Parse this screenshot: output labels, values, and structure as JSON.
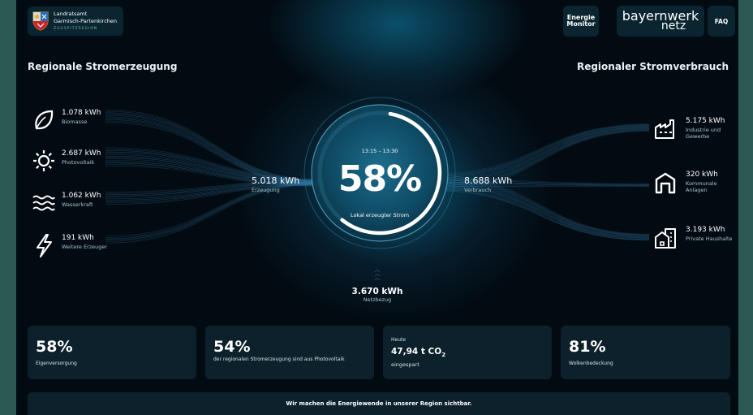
{
  "header": {
    "logo": {
      "line1": "Landratsamt",
      "line2": "Garmisch-Partenkirchen",
      "line3": "ZUGSPITZREGION"
    },
    "energy_monitor": {
      "line1": "Energie",
      "line2": "Monitor"
    },
    "bayernwerk": {
      "line1": "bayernwerk",
      "line2": "netz"
    },
    "faq": "FAQ"
  },
  "left_title": "Regionale Stromerzeugung",
  "right_title": "Regionaler Stromverbrauch",
  "sources": [
    {
      "value": "1.078 kWh",
      "label": "Biomasse",
      "icon": "leaf-icon"
    },
    {
      "value": "2.687 kWh",
      "label": "Photovoltaik",
      "icon": "sun-icon"
    },
    {
      "value": "1.062 kWh",
      "label": "Wasserkraft",
      "icon": "waves-icon"
    },
    {
      "value": "191 kWh",
      "label": "Weitere Erzeuger",
      "icon": "lightning-icon"
    }
  ],
  "generation_total": {
    "value": "5.018 kWh",
    "label": "Erzeugung"
  },
  "consumption_total": {
    "value": "8.688 kWh",
    "label": "Verbrauch"
  },
  "consumers": [
    {
      "value": "5.175 kWh",
      "label": "Industrie und Gewerbe",
      "icon": "factory-icon"
    },
    {
      "value": "320 kWh",
      "label": "Kommunale Anlagen",
      "icon": "hall-icon"
    },
    {
      "value": "3.193 kWh",
      "label": "Private Haushalte",
      "icon": "house-icon"
    }
  ],
  "center": {
    "time": "13:15 – 13:30",
    "percent": "58%",
    "percent_value": 0.58,
    "label": "Lokal erzeugter Strom"
  },
  "grid_import": {
    "value": "3.670 kWh",
    "label": "Netzbezug"
  },
  "cards": [
    {
      "big": "58%",
      "small": "Eigenversorgung"
    },
    {
      "big": "54%",
      "small": "der regionalen Stromerzeugung sind aus Photovoltaik"
    },
    {
      "pre": "Heute",
      "value": "47,94 t CO",
      "sub": "2",
      "post": "eingespart"
    },
    {
      "big": "81%",
      "small": "Wolkenbedeckung"
    }
  ],
  "banner": "Wir machen die Energiewende in unserer Region sichtbar.",
  "colors": {
    "accent": "#5fb7e6",
    "card": "#0c212b",
    "background": "#030b12",
    "frame": "#2b5a53"
  }
}
